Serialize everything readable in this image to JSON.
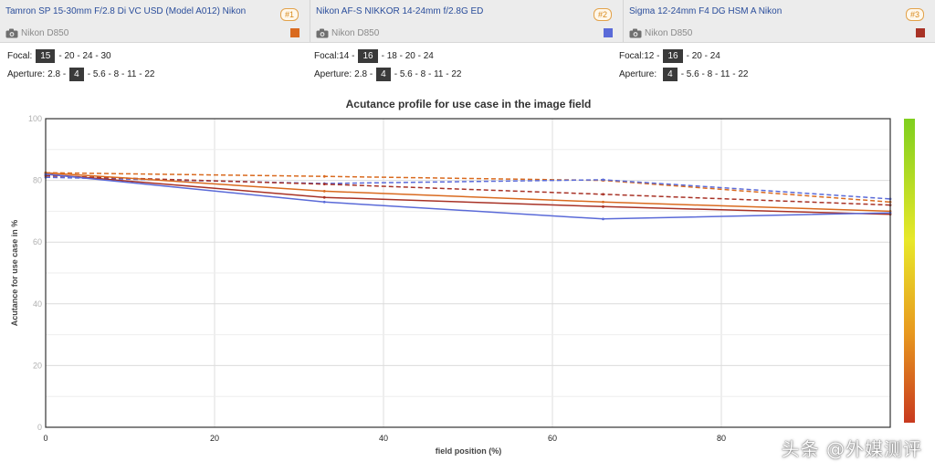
{
  "lenses": [
    {
      "name": "Tamron SP 15-30mm F/2.8 Di VC USD (Model A012) Nikon",
      "rank": "#1",
      "camera": "Nikon D850",
      "color": "#d96a1f"
    },
    {
      "name": "Nikon AF-S NIKKOR 14-24mm f/2.8G ED",
      "rank": "#2",
      "camera": "Nikon D850",
      "color": "#5a6ad8"
    },
    {
      "name": "Sigma 12-24mm F4 DG HSM A Nikon",
      "rank": "#3",
      "camera": "Nikon D850",
      "color": "#a83226"
    }
  ],
  "settings": [
    {
      "focal": {
        "label": "Focal:",
        "before": "",
        "selected": "15",
        "after": "- 20 - 24 - 30"
      },
      "aperture": {
        "label": "Aperture:",
        "before": "2.8 -",
        "selected": "4",
        "after": "- 5.6 - 8 - 11 - 22"
      }
    },
    {
      "focal": {
        "label": "Focal:",
        "before": "14 -",
        "selected": "16",
        "after": "- 18 - 20 - 24"
      },
      "aperture": {
        "label": "Aperture:",
        "before": "2.8 -",
        "selected": "4",
        "after": "- 5.6 - 8 - 11 - 22"
      }
    },
    {
      "focal": {
        "label": "Focal:",
        "before": "12 -",
        "selected": "16",
        "after": "- 20 - 24"
      },
      "aperture": {
        "label": "Aperture:",
        "before": "",
        "selected": "4",
        "after": "- 5.6 - 8 - 11 - 22"
      }
    }
  ],
  "watermark": "头条 @外媒测评",
  "chart_data": {
    "type": "line",
    "title": "Acutance profile for use case in the image field",
    "xlabel": "field position (%)",
    "ylabel": "Acutance for use case in %",
    "xlim": [
      0,
      100
    ],
    "ylim": [
      0,
      100
    ],
    "xticks": [
      0,
      20,
      40,
      60,
      80
    ],
    "yticks": [
      0,
      20,
      40,
      60,
      80,
      100
    ],
    "grid": true,
    "legend": "none",
    "colorbar": {
      "gradient": [
        "#7fcf1f",
        "#e8e82a",
        "#e89a1f",
        "#c83a1f"
      ]
    },
    "series": [
      {
        "color": "#d96a1f",
        "dash": true,
        "points": [
          [
            0,
            82.5
          ],
          [
            33,
            81.3
          ],
          [
            66,
            80.0
          ],
          [
            100,
            73.0
          ]
        ]
      },
      {
        "color": "#5a6ad8",
        "dash": true,
        "points": [
          [
            0,
            81.0
          ],
          [
            33,
            79.0
          ],
          [
            66,
            80.2
          ],
          [
            100,
            74.0
          ]
        ]
      },
      {
        "color": "#a83226",
        "dash": true,
        "points": [
          [
            0,
            81.5
          ],
          [
            33,
            78.8
          ],
          [
            66,
            75.5
          ],
          [
            100,
            72.0
          ]
        ]
      },
      {
        "color": "#d96a1f",
        "dash": false,
        "points": [
          [
            0,
            82.5
          ],
          [
            33,
            76.5
          ],
          [
            66,
            73.0
          ],
          [
            100,
            70.0
          ]
        ]
      },
      {
        "color": "#a83226",
        "dash": false,
        "points": [
          [
            0,
            82.0
          ],
          [
            33,
            74.5
          ],
          [
            66,
            71.5
          ],
          [
            100,
            69.0
          ]
        ]
      },
      {
        "color": "#5a6ad8",
        "dash": false,
        "points": [
          [
            0,
            82.0
          ],
          [
            33,
            73.0
          ],
          [
            66,
            67.5
          ],
          [
            100,
            69.5
          ]
        ]
      }
    ]
  }
}
